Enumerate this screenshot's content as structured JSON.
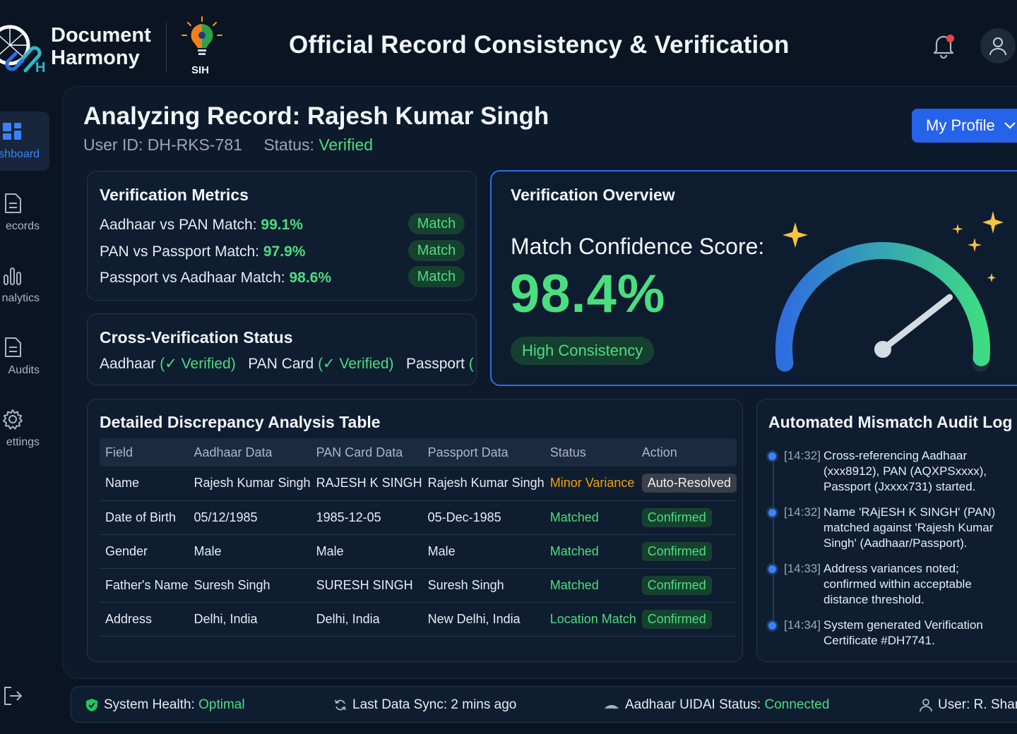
{
  "header": {
    "brand_line1": "Document",
    "brand_line2": "Harmony",
    "logo_letter": "H",
    "partner_logo_text": "SIH",
    "title": "Official Record Consistency & Verification"
  },
  "sidebar": {
    "items": [
      {
        "label": "shboard",
        "icon": "dashboard-icon",
        "active": true
      },
      {
        "label": "ecords",
        "icon": "document-icon",
        "active": false
      },
      {
        "label": "nalytics",
        "icon": "bar-chart-icon",
        "active": false
      },
      {
        "label": "Audits",
        "icon": "document-icon",
        "active": false
      },
      {
        "label": "ettings",
        "icon": "gear-icon",
        "active": false
      }
    ],
    "logout_icon": "logout-icon"
  },
  "record": {
    "title": "Analyzing Record: Rajesh Kumar Singh",
    "user_id": "User ID: DH-RKS-781",
    "status_label": "Status:",
    "status_value": "Verified",
    "profile_button": "My Profile"
  },
  "metrics": {
    "title": "Verification Metrics",
    "rows": [
      {
        "label": "Aadhaar vs PAN Match:",
        "value": "99.1%",
        "badge": "Match"
      },
      {
        "label": "PAN vs Passport Match:",
        "value": "97.9%",
        "badge": "Match"
      },
      {
        "label": "Passport vs Aadhaar Match:",
        "value": "98.6%",
        "badge": "Match"
      }
    ]
  },
  "cross_verification": {
    "title": "Cross-Verification Status",
    "items": [
      {
        "name": "Aadhaar",
        "status": "(✓ Verified)"
      },
      {
        "name": "PAN Card",
        "status": "(✓ Verified)"
      },
      {
        "name": "Passport",
        "status": "(✓"
      }
    ]
  },
  "overview": {
    "title": "Verification Overview",
    "score_label": "Match Confidence Score:",
    "score_value": "98.4%",
    "score_fraction": 0.984,
    "badge": "High Consistency"
  },
  "table": {
    "title": "Detailed Discrepancy Analysis Table",
    "columns": [
      "Field",
      "Aadhaar Data",
      "PAN Card Data",
      "Passport Data",
      "Status",
      "Action"
    ],
    "rows": [
      {
        "field": "Name",
        "aadhaar": "Rajesh Kumar Singh",
        "pan": "RAJESH K SINGH",
        "passport": "Rajesh Kumar Singh",
        "status": "Minor Variance",
        "status_color": "#f59e0b",
        "action": "Auto-Resolved"
      },
      {
        "field": "Date of Birth",
        "aadhaar": "05/12/1985",
        "pan": "1985-12-05",
        "passport": "05-Dec-1985",
        "status": "Matched",
        "status_color": "#4ade80",
        "action": "Confirmed"
      },
      {
        "field": "Gender",
        "aadhaar": "Male",
        "pan": "Male",
        "passport": "Male",
        "status": "Matched",
        "status_color": "#4ade80",
        "action": "Confirmed"
      },
      {
        "field": "Father's Name",
        "aadhaar": "Suresh Singh",
        "pan": "SURESH SINGH",
        "passport": "Suresh Singh",
        "status": "Matched",
        "status_color": "#4ade80",
        "action": "Confirmed"
      },
      {
        "field": "Address",
        "aadhaar": "Delhi, India",
        "pan": "Delhi, India",
        "passport": "New Delhi, India",
        "status": "Location Match",
        "status_color": "#4ade80",
        "action": "Confirmed"
      }
    ]
  },
  "audit_log": {
    "title": "Automated Mismatch Audit Log",
    "entries": [
      {
        "time": "[14:32]",
        "text": "Cross-referencing Aadhaar (xxx8912), PAN (AQXPSxxxx), Passport (Jxxxx731) started."
      },
      {
        "time": "[14:32]",
        "text": "Name 'RAjESH K SINGH' (PAN) matched against 'Rajesh Kumar Singh' (Aadhaar/Passport)."
      },
      {
        "time": "[14:33]",
        "text": "Address variances noted; confirmed within acceptable distance threshold."
      },
      {
        "time": "[14:34]",
        "text": "System generated Verification Certificate #DH7741."
      }
    ]
  },
  "status_bar": {
    "health_label": "System Health:",
    "health_value": "Optimal",
    "sync_text": "Last Data Sync: 2 mins ago",
    "uidai_label": "Aadhaar UIDAI Status:",
    "uidai_value": "Connected",
    "user_text": "User: R. Sharm"
  },
  "colors": {
    "accent_blue": "#2563eb",
    "success_green": "#4ade80",
    "warning_orange": "#f59e0b",
    "background": "#0a1422"
  }
}
